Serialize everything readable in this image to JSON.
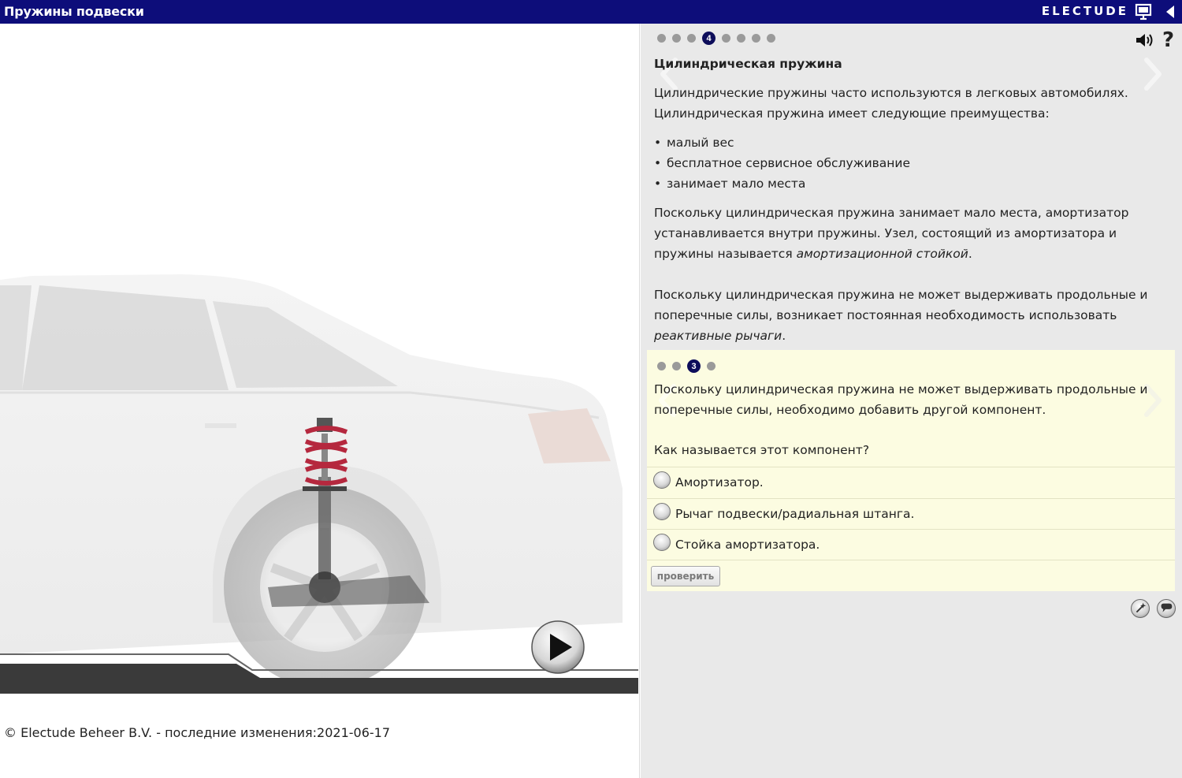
{
  "header": {
    "title": "Пружины подвески",
    "brand": "ELECTUDE",
    "present_icon": "presentation-screen-icon",
    "collapse_icon": "triangle-left-icon"
  },
  "left": {
    "play_icon": "play-icon",
    "copyright": "© Electude Beheer B.V. - последние изменения:2021-06-17"
  },
  "page_nav": {
    "total_pages": 8,
    "current_page": "4",
    "prev_icon": "chevron-left-icon",
    "next_icon": "chevron-right-icon",
    "audio_icon": "speaker-icon",
    "help": "?"
  },
  "content": {
    "title": "Цилиндрическая пружина",
    "intro": "Цилиндрические пружины часто используются в легковых автомобилях. Цилиндрическая пружина имеет следующие преимущества:",
    "bullets": [
      "малый вес",
      "бесплатное сервисное обслуживание",
      "занимает мало места"
    ],
    "para2_a": "Поскольку цилиндрическая пружина занимает мало места, амортизатор устанавливается внутри пружины. Узел, состоящий из амортизатора и пружины называется ",
    "para2_em": "амортизационной стойкой",
    "para2_b": ".",
    "para3_a": "Поскольку цилиндрическая пружина не может выдерживать продольные и поперечные силы, возникает постоянная необходимость использовать ",
    "para3_em": "реактивные рычаги",
    "para3_b": "."
  },
  "quiz": {
    "total_steps": 4,
    "current_step": "3",
    "statement": "Поскольку цилиндрическая пружина не может выдерживать продольные и поперечные силы, необходимо добавить другой компонент.",
    "question": "Как называется этот компонент?",
    "options": [
      "Амортизатор.",
      "Рычаг подвески/радиальная штанга.",
      "Стойка амортизатора."
    ],
    "check_label": "проверить"
  },
  "tools": {
    "tool1_icon": "magic-wand-icon",
    "tool2_icon": "speech-bubble-icon"
  },
  "colors": {
    "header_bg": "#0d0d7a",
    "panel_bg": "#e9e9e9",
    "quiz_bg": "#fcfce1",
    "spring": "#b5283e"
  }
}
